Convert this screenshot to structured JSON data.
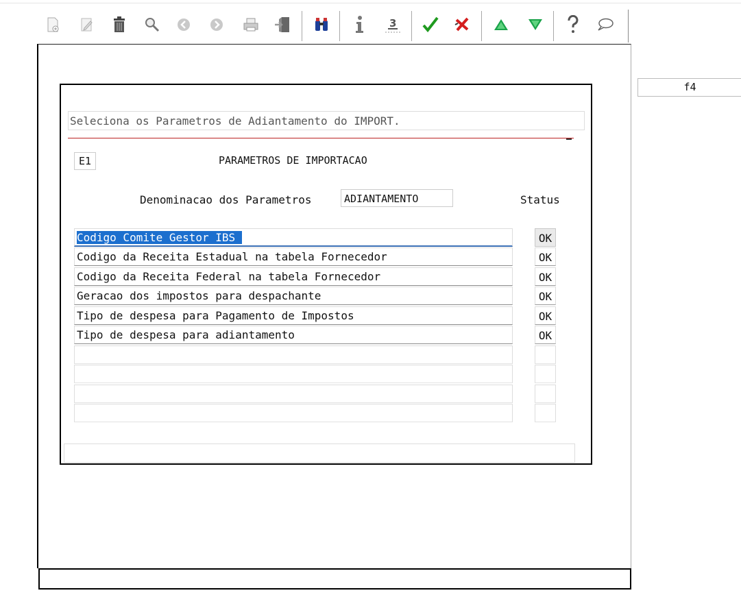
{
  "toolbar": {
    "buttons": [
      {
        "id": "new",
        "icon": "new-document-icon"
      },
      {
        "id": "edit",
        "icon": "pencil-icon"
      },
      {
        "id": "delete",
        "icon": "trash-icon"
      },
      {
        "id": "search",
        "icon": "magnifier-icon"
      },
      {
        "id": "previous",
        "icon": "circle-left-icon"
      },
      {
        "id": "next",
        "icon": "circle-right-icon"
      },
      {
        "id": "print",
        "icon": "printer-icon"
      },
      {
        "id": "exit",
        "icon": "exit-door-icon"
      },
      {
        "id": "find",
        "icon": "binoculars-icon"
      },
      {
        "id": "info",
        "icon": "info-icon"
      },
      {
        "id": "number",
        "icon": "numeric-3-icon",
        "glyph": "3"
      },
      {
        "id": "confirm",
        "icon": "checkmark-icon"
      },
      {
        "id": "cancel",
        "icon": "cross-icon"
      },
      {
        "id": "up",
        "icon": "triangle-up-icon"
      },
      {
        "id": "down",
        "icon": "triangle-down-icon"
      },
      {
        "id": "help",
        "icon": "question-mark-icon",
        "glyph": "?"
      },
      {
        "id": "comment",
        "icon": "speech-bubble-icon"
      }
    ],
    "colors": {
      "confirm": "#1f9a1f",
      "cancel": "#d41e1e",
      "up": "#1aa34a",
      "down": "#1aa34a",
      "find": "#1d3f99"
    }
  },
  "side": {
    "f4_label": "f4"
  },
  "panel": {
    "header": "Seleciona os Parametros de Adiantamento do IMPORT.",
    "code": "E1",
    "title": "PARAMETROS DE IMPORTACAO",
    "denominacao_label": "Denominacao dos Parametros",
    "denominacao_value": "ADIANTAMENTO",
    "status_header": "Status",
    "rows": [
      {
        "label": "Codigo Comite Gestor IBS",
        "status": "OK",
        "selected": true
      },
      {
        "label": "Codigo da Receita Estadual na tabela Fornecedor",
        "status": "OK"
      },
      {
        "label": "Codigo da Receita Federal na tabela Fornecedor",
        "status": "OK"
      },
      {
        "label": "Geracao dos impostos para despachante",
        "status": "OK"
      },
      {
        "label": "Tipo de despesa para Pagamento de Impostos",
        "status": "OK"
      },
      {
        "label": "Tipo de despesa para adiantamento",
        "status": "OK"
      },
      {
        "label": "",
        "status": ""
      },
      {
        "label": "",
        "status": ""
      },
      {
        "label": "",
        "status": ""
      },
      {
        "label": "",
        "status": ""
      }
    ],
    "message": ""
  },
  "colors": {
    "selection": "#1c6fce",
    "divider": "#b22222"
  }
}
